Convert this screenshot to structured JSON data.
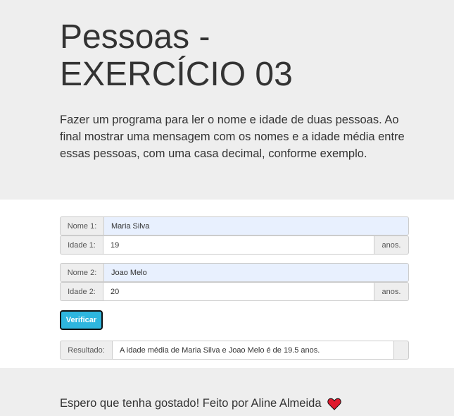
{
  "header": {
    "title_line1": "Pessoas -",
    "title_line2": "EXERCÍCIO 03",
    "description": "Fazer um programa para ler o nome e idade de duas pessoas. Ao final mostrar uma mensagem com os nomes e a idade média entre essas pessoas, com uma casa decimal, conforme exemplo."
  },
  "form": {
    "nome1_label": "Nome 1:",
    "nome1_value": "Maria Silva",
    "idade1_label": "Idade 1:",
    "idade1_value": "19",
    "idade1_suffix": "anos.",
    "nome2_label": "Nome 2:",
    "nome2_value": "Joao Melo",
    "idade2_label": "Idade 2:",
    "idade2_value": "20",
    "idade2_suffix": "anos.",
    "button_label": "Verificar",
    "resultado_label": "Resultado:",
    "resultado_value": "A idade média de Maria Silva e Joao Melo é de 19.5 anos."
  },
  "footer": {
    "text": "Espero que tenha gostado! Feito por Aline Almeida",
    "icon": "heart-icon",
    "accent_color": "#2eb6df",
    "heart_color": "#e0192d"
  }
}
